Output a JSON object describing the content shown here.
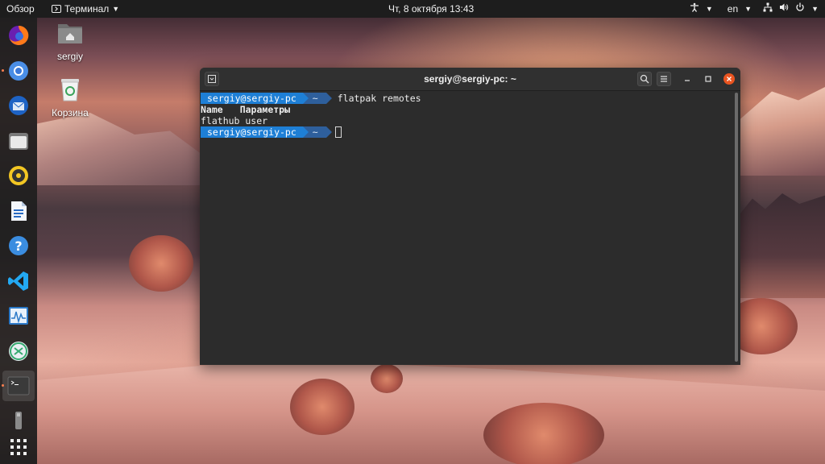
{
  "topbar": {
    "overview_label": "Обзор",
    "app_menu_label": "Терминал",
    "clock": "Чт, 8 октября  13:43",
    "language": "en",
    "icons": [
      "accessibility-icon",
      "network-icon",
      "volume-icon",
      "power-icon"
    ]
  },
  "dock": {
    "items": [
      {
        "name": "firefox",
        "icon": "firefox-icon"
      },
      {
        "name": "chromium",
        "icon": "chromium-icon"
      },
      {
        "name": "thunderbird",
        "icon": "thunderbird-icon"
      },
      {
        "name": "files",
        "icon": "files-icon"
      },
      {
        "name": "rhythmbox",
        "icon": "rhythmbox-icon"
      },
      {
        "name": "writer",
        "icon": "libreoffice-writer-icon"
      },
      {
        "name": "help",
        "icon": "help-icon"
      },
      {
        "name": "vscode",
        "icon": "vscode-icon"
      },
      {
        "name": "system-monitor",
        "icon": "system-monitor-icon"
      },
      {
        "name": "software-updater",
        "icon": "updater-icon"
      },
      {
        "name": "terminal",
        "icon": "terminal-icon",
        "active": true
      },
      {
        "name": "usb-drive",
        "icon": "usb-drive-icon"
      },
      {
        "name": "show-applications",
        "icon": "grid-icon"
      }
    ]
  },
  "desktop": {
    "home_label": "sergiy",
    "trash_label": "Корзина"
  },
  "terminal": {
    "title": "sergiy@sergiy-pc: ~",
    "prompt_user": "sergiy@sergiy-pc",
    "prompt_dir": "~",
    "command": "flatpak remotes",
    "header_name": "Name",
    "header_params": "Параметры",
    "output_row": "flathub user"
  },
  "colors": {
    "accent": "#e95420",
    "prompt_user_bg": "#1e7fd6",
    "prompt_dir_bg": "#2e5f9c",
    "terminal_bg": "#2c2c2c"
  }
}
